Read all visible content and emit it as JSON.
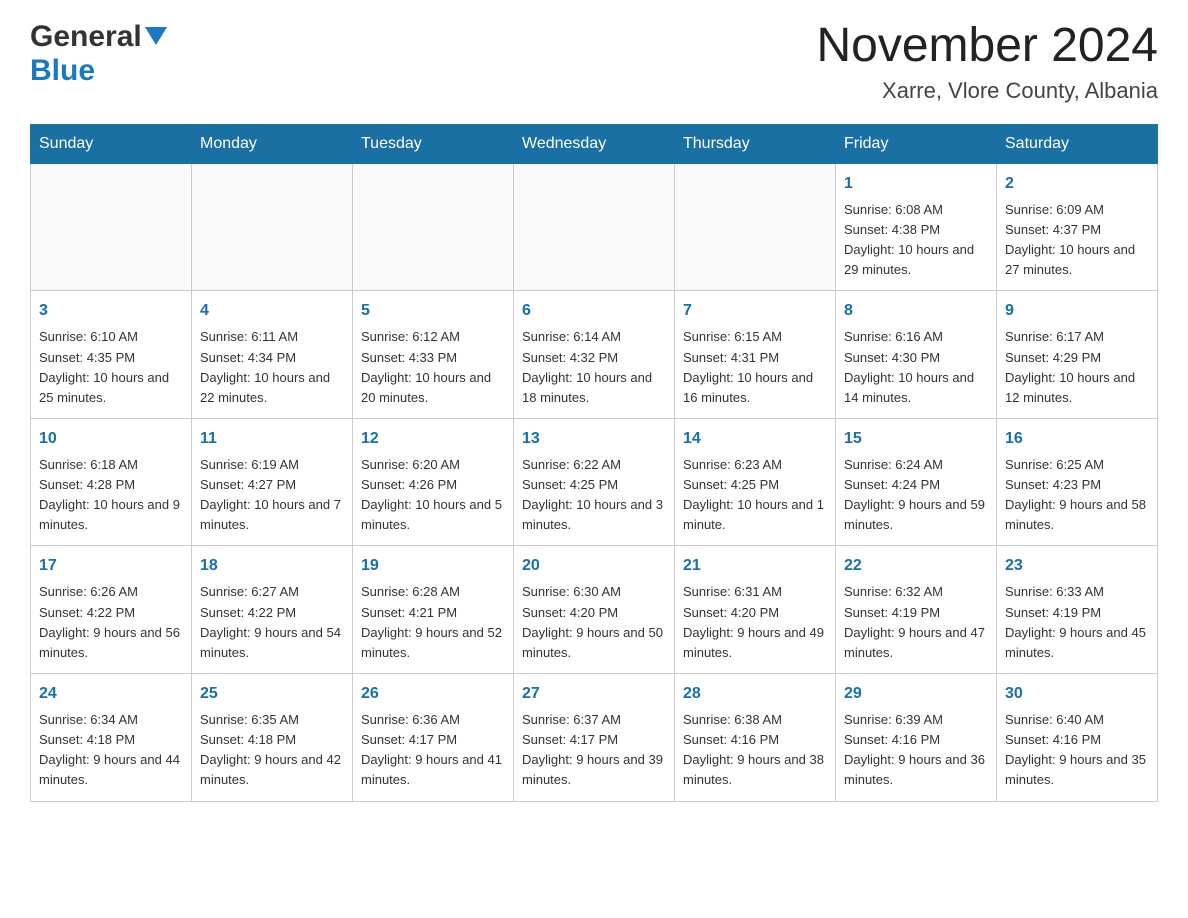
{
  "header": {
    "logo_general": "General",
    "logo_blue": "Blue",
    "month_title": "November 2024",
    "location": "Xarre, Vlore County, Albania"
  },
  "calendar": {
    "weekdays": [
      "Sunday",
      "Monday",
      "Tuesday",
      "Wednesday",
      "Thursday",
      "Friday",
      "Saturday"
    ],
    "rows": [
      [
        {
          "day": "",
          "sunrise": "",
          "sunset": "",
          "daylight": ""
        },
        {
          "day": "",
          "sunrise": "",
          "sunset": "",
          "daylight": ""
        },
        {
          "day": "",
          "sunrise": "",
          "sunset": "",
          "daylight": ""
        },
        {
          "day": "",
          "sunrise": "",
          "sunset": "",
          "daylight": ""
        },
        {
          "day": "",
          "sunrise": "",
          "sunset": "",
          "daylight": ""
        },
        {
          "day": "1",
          "sunrise": "Sunrise: 6:08 AM",
          "sunset": "Sunset: 4:38 PM",
          "daylight": "Daylight: 10 hours and 29 minutes."
        },
        {
          "day": "2",
          "sunrise": "Sunrise: 6:09 AM",
          "sunset": "Sunset: 4:37 PM",
          "daylight": "Daylight: 10 hours and 27 minutes."
        }
      ],
      [
        {
          "day": "3",
          "sunrise": "Sunrise: 6:10 AM",
          "sunset": "Sunset: 4:35 PM",
          "daylight": "Daylight: 10 hours and 25 minutes."
        },
        {
          "day": "4",
          "sunrise": "Sunrise: 6:11 AM",
          "sunset": "Sunset: 4:34 PM",
          "daylight": "Daylight: 10 hours and 22 minutes."
        },
        {
          "day": "5",
          "sunrise": "Sunrise: 6:12 AM",
          "sunset": "Sunset: 4:33 PM",
          "daylight": "Daylight: 10 hours and 20 minutes."
        },
        {
          "day": "6",
          "sunrise": "Sunrise: 6:14 AM",
          "sunset": "Sunset: 4:32 PM",
          "daylight": "Daylight: 10 hours and 18 minutes."
        },
        {
          "day": "7",
          "sunrise": "Sunrise: 6:15 AM",
          "sunset": "Sunset: 4:31 PM",
          "daylight": "Daylight: 10 hours and 16 minutes."
        },
        {
          "day": "8",
          "sunrise": "Sunrise: 6:16 AM",
          "sunset": "Sunset: 4:30 PM",
          "daylight": "Daylight: 10 hours and 14 minutes."
        },
        {
          "day": "9",
          "sunrise": "Sunrise: 6:17 AM",
          "sunset": "Sunset: 4:29 PM",
          "daylight": "Daylight: 10 hours and 12 minutes."
        }
      ],
      [
        {
          "day": "10",
          "sunrise": "Sunrise: 6:18 AM",
          "sunset": "Sunset: 4:28 PM",
          "daylight": "Daylight: 10 hours and 9 minutes."
        },
        {
          "day": "11",
          "sunrise": "Sunrise: 6:19 AM",
          "sunset": "Sunset: 4:27 PM",
          "daylight": "Daylight: 10 hours and 7 minutes."
        },
        {
          "day": "12",
          "sunrise": "Sunrise: 6:20 AM",
          "sunset": "Sunset: 4:26 PM",
          "daylight": "Daylight: 10 hours and 5 minutes."
        },
        {
          "day": "13",
          "sunrise": "Sunrise: 6:22 AM",
          "sunset": "Sunset: 4:25 PM",
          "daylight": "Daylight: 10 hours and 3 minutes."
        },
        {
          "day": "14",
          "sunrise": "Sunrise: 6:23 AM",
          "sunset": "Sunset: 4:25 PM",
          "daylight": "Daylight: 10 hours and 1 minute."
        },
        {
          "day": "15",
          "sunrise": "Sunrise: 6:24 AM",
          "sunset": "Sunset: 4:24 PM",
          "daylight": "Daylight: 9 hours and 59 minutes."
        },
        {
          "day": "16",
          "sunrise": "Sunrise: 6:25 AM",
          "sunset": "Sunset: 4:23 PM",
          "daylight": "Daylight: 9 hours and 58 minutes."
        }
      ],
      [
        {
          "day": "17",
          "sunrise": "Sunrise: 6:26 AM",
          "sunset": "Sunset: 4:22 PM",
          "daylight": "Daylight: 9 hours and 56 minutes."
        },
        {
          "day": "18",
          "sunrise": "Sunrise: 6:27 AM",
          "sunset": "Sunset: 4:22 PM",
          "daylight": "Daylight: 9 hours and 54 minutes."
        },
        {
          "day": "19",
          "sunrise": "Sunrise: 6:28 AM",
          "sunset": "Sunset: 4:21 PM",
          "daylight": "Daylight: 9 hours and 52 minutes."
        },
        {
          "day": "20",
          "sunrise": "Sunrise: 6:30 AM",
          "sunset": "Sunset: 4:20 PM",
          "daylight": "Daylight: 9 hours and 50 minutes."
        },
        {
          "day": "21",
          "sunrise": "Sunrise: 6:31 AM",
          "sunset": "Sunset: 4:20 PM",
          "daylight": "Daylight: 9 hours and 49 minutes."
        },
        {
          "day": "22",
          "sunrise": "Sunrise: 6:32 AM",
          "sunset": "Sunset: 4:19 PM",
          "daylight": "Daylight: 9 hours and 47 minutes."
        },
        {
          "day": "23",
          "sunrise": "Sunrise: 6:33 AM",
          "sunset": "Sunset: 4:19 PM",
          "daylight": "Daylight: 9 hours and 45 minutes."
        }
      ],
      [
        {
          "day": "24",
          "sunrise": "Sunrise: 6:34 AM",
          "sunset": "Sunset: 4:18 PM",
          "daylight": "Daylight: 9 hours and 44 minutes."
        },
        {
          "day": "25",
          "sunrise": "Sunrise: 6:35 AM",
          "sunset": "Sunset: 4:18 PM",
          "daylight": "Daylight: 9 hours and 42 minutes."
        },
        {
          "day": "26",
          "sunrise": "Sunrise: 6:36 AM",
          "sunset": "Sunset: 4:17 PM",
          "daylight": "Daylight: 9 hours and 41 minutes."
        },
        {
          "day": "27",
          "sunrise": "Sunrise: 6:37 AM",
          "sunset": "Sunset: 4:17 PM",
          "daylight": "Daylight: 9 hours and 39 minutes."
        },
        {
          "day": "28",
          "sunrise": "Sunrise: 6:38 AM",
          "sunset": "Sunset: 4:16 PM",
          "daylight": "Daylight: 9 hours and 38 minutes."
        },
        {
          "day": "29",
          "sunrise": "Sunrise: 6:39 AM",
          "sunset": "Sunset: 4:16 PM",
          "daylight": "Daylight: 9 hours and 36 minutes."
        },
        {
          "day": "30",
          "sunrise": "Sunrise: 6:40 AM",
          "sunset": "Sunset: 4:16 PM",
          "daylight": "Daylight: 9 hours and 35 minutes."
        }
      ]
    ]
  }
}
